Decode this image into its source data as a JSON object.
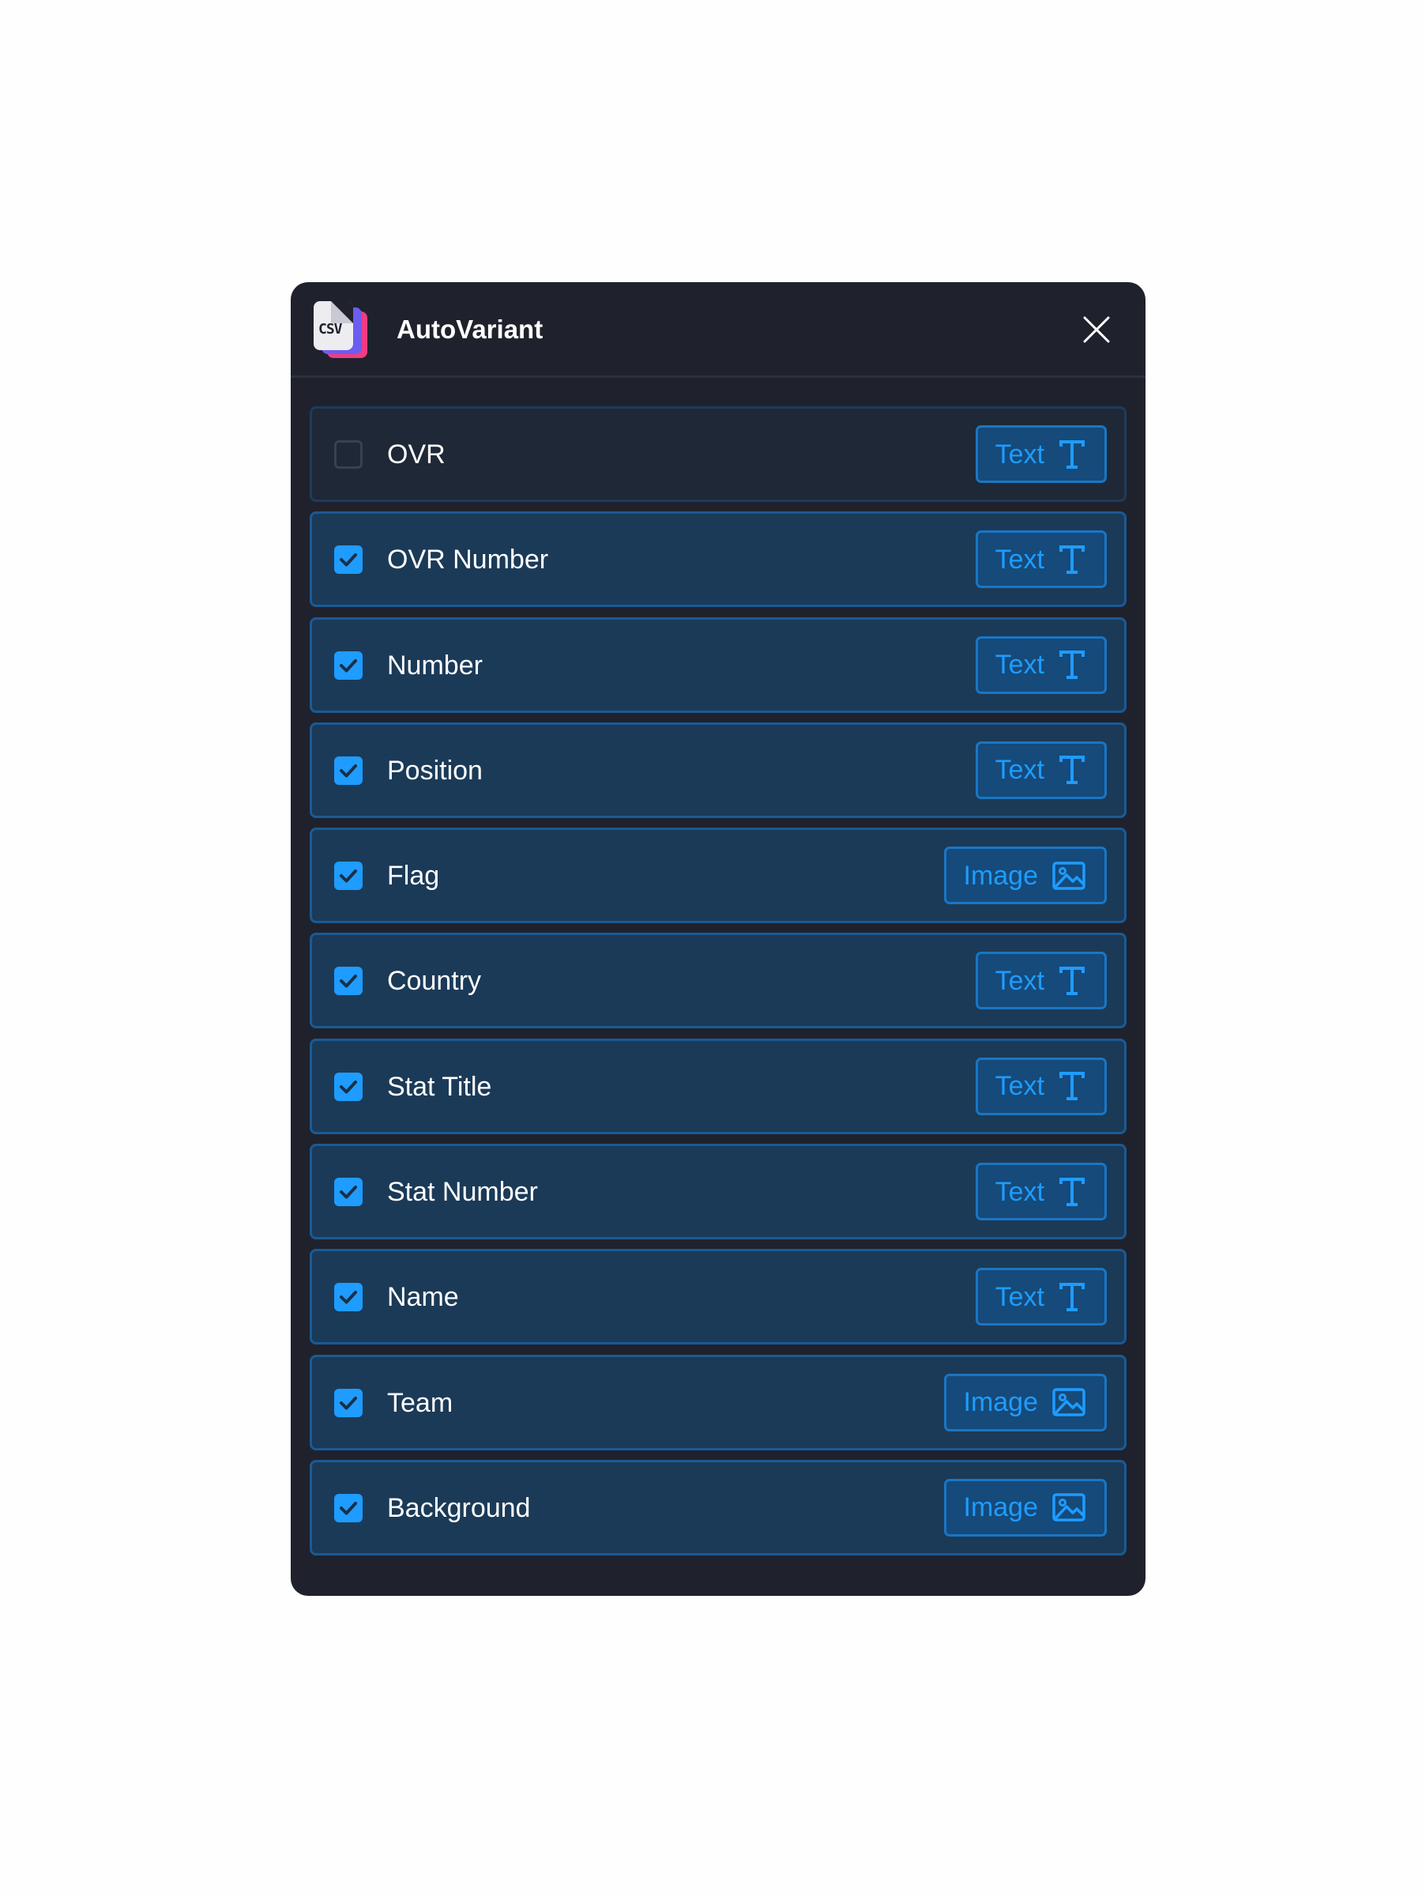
{
  "app": {
    "title": "AutoVariant",
    "logo_text": "CSV"
  },
  "colors": {
    "panel_bg": "#1f222d",
    "row_bg": "#1b3a57",
    "accent": "#1e9cff",
    "logo_pink": "#ef3c83",
    "logo_purple": "#6c5cf0"
  },
  "fields": [
    {
      "label": "OVR",
      "checked": false,
      "type": "Text",
      "icon": "text-type-icon"
    },
    {
      "label": "OVR Number",
      "checked": true,
      "type": "Text",
      "icon": "text-type-icon"
    },
    {
      "label": "Number",
      "checked": true,
      "type": "Text",
      "icon": "text-type-icon"
    },
    {
      "label": "Position",
      "checked": true,
      "type": "Text",
      "icon": "text-type-icon"
    },
    {
      "label": "Flag",
      "checked": true,
      "type": "Image",
      "icon": "image-type-icon"
    },
    {
      "label": "Country",
      "checked": true,
      "type": "Text",
      "icon": "text-type-icon"
    },
    {
      "label": "Stat Title",
      "checked": true,
      "type": "Text",
      "icon": "text-type-icon"
    },
    {
      "label": "Stat Number",
      "checked": true,
      "type": "Text",
      "icon": "text-type-icon"
    },
    {
      "label": "Name",
      "checked": true,
      "type": "Text",
      "icon": "text-type-icon"
    },
    {
      "label": "Team",
      "checked": true,
      "type": "Image",
      "icon": "image-type-icon"
    },
    {
      "label": "Background",
      "checked": true,
      "type": "Image",
      "icon": "image-type-icon"
    }
  ]
}
